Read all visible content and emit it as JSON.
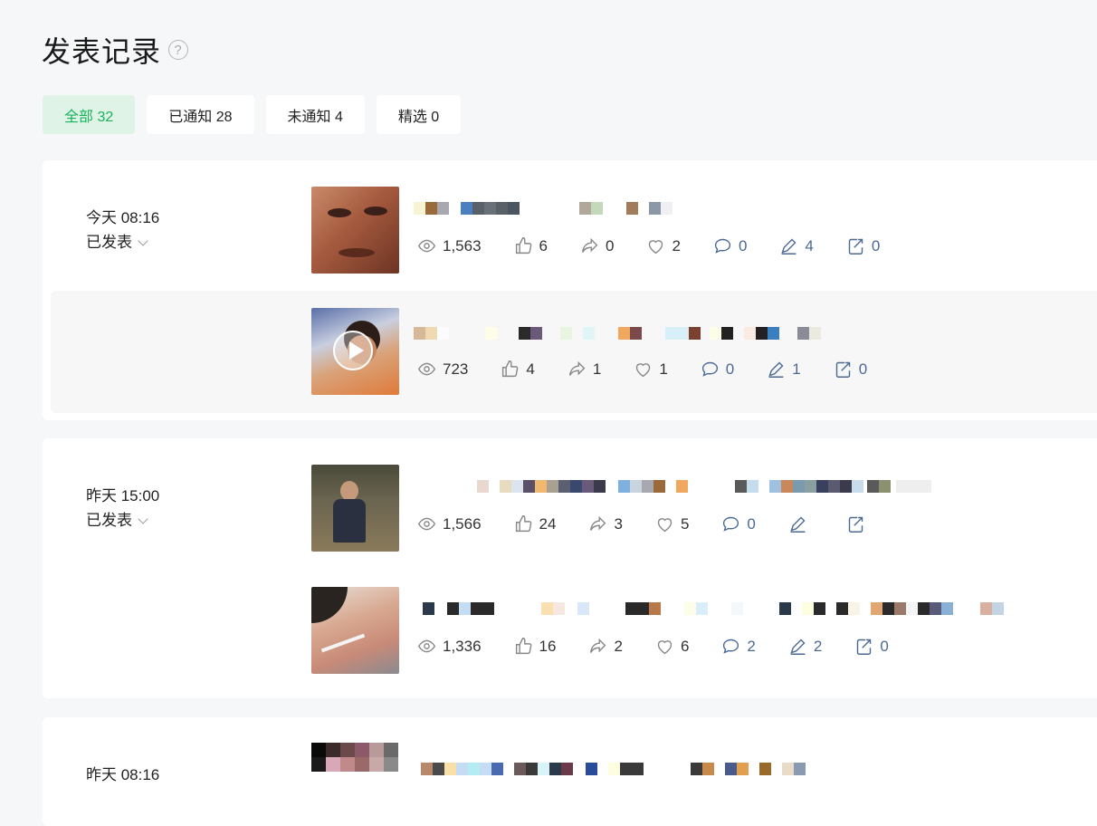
{
  "page": {
    "title": "发表记录"
  },
  "tabs": [
    {
      "label": "全部 32",
      "active": true
    },
    {
      "label": "已通知 28",
      "active": false
    },
    {
      "label": "未通知 4",
      "active": false
    },
    {
      "label": "精选 0",
      "active": false
    }
  ],
  "groups": [
    {
      "time": "今天 08:16",
      "status": "已发表",
      "posts": [
        {
          "views": "1,563",
          "likes": "6",
          "shares": "0",
          "favs": "2",
          "comments": "0",
          "edits": "4",
          "reposts": "0",
          "video": false
        },
        {
          "views": "723",
          "likes": "4",
          "shares": "1",
          "favs": "1",
          "comments": "0",
          "edits": "1",
          "reposts": "0",
          "video": true
        }
      ]
    },
    {
      "time": "昨天 15:00",
      "status": "已发表",
      "posts": [
        {
          "views": "1,566",
          "likes": "24",
          "shares": "3",
          "favs": "5",
          "comments": "0",
          "edits": "",
          "reposts": "",
          "video": false
        },
        {
          "views": "1,336",
          "likes": "16",
          "shares": "2",
          "favs": "6",
          "comments": "2",
          "edits": "2",
          "reposts": "0",
          "video": false
        }
      ]
    },
    {
      "time": "昨天 08:16",
      "status": "",
      "posts": []
    }
  ],
  "colors": {
    "accent": "#19b25b",
    "tab_active_bg": "#dff3e6",
    "stat_blue": "#4a6a94"
  }
}
